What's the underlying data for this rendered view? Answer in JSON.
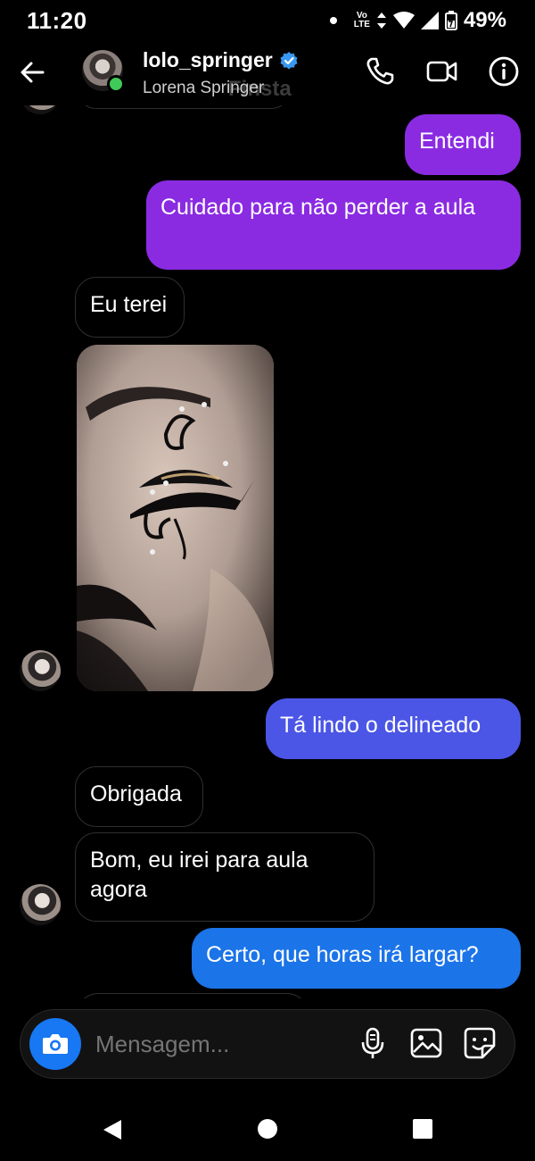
{
  "status_bar": {
    "time": "11:20",
    "network_label_top": "Vo",
    "network_label_bottom": "LTE",
    "battery": "49%"
  },
  "header": {
    "username": "lolo_springer",
    "full_name": "Lorena Springer",
    "ghost_text": "Finsta",
    "verified_color": "#3897f0",
    "online_color": "#3fca5a"
  },
  "messages": [
    {
      "id": "m1",
      "direction": "out",
      "text": "Entendi",
      "color": "#8a2be2"
    },
    {
      "id": "m2",
      "direction": "out",
      "text": "Cuidado para não perder a aula",
      "color": "#8a2be2"
    },
    {
      "id": "m3",
      "direction": "in",
      "text": "Eu terei"
    },
    {
      "id": "m4",
      "direction": "in",
      "type": "photo"
    },
    {
      "id": "m5",
      "direction": "out",
      "text": "Tá lindo o delineado",
      "color": "#4b56e6"
    },
    {
      "id": "m6",
      "direction": "in",
      "text": "Obrigada"
    },
    {
      "id": "m7",
      "direction": "in",
      "text": "Bom, eu irei para aula agora"
    },
    {
      "id": "m8",
      "direction": "out",
      "text": "Certo, que horas irá largar?",
      "color": "#1b74e8"
    }
  ],
  "composer": {
    "placeholder": "Mensagem...",
    "camera_color": "#1877f2"
  },
  "icons": {
    "back": "back-arrow-icon",
    "call": "phone-icon",
    "video": "video-icon",
    "info": "info-icon",
    "camera": "camera-icon",
    "mic": "microphone-icon",
    "gallery": "image-icon",
    "sticker": "sticker-icon"
  }
}
